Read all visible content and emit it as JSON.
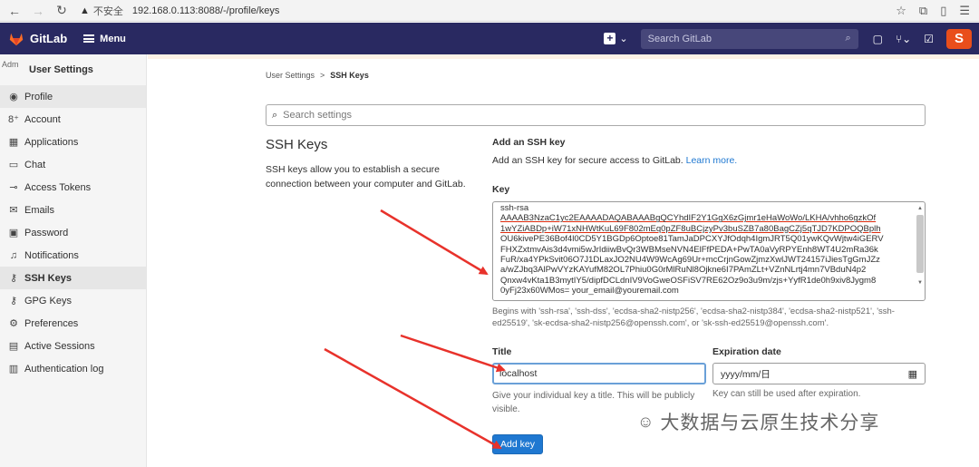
{
  "browser": {
    "insecure_label": "不安全",
    "url": "192.168.0.113:8088/-/profile/keys"
  },
  "header": {
    "brand": "GitLab",
    "menu_label": "Menu",
    "search_placeholder": "Search GitLab",
    "badge_letter": "S"
  },
  "sidebar": {
    "avatar_alt": "Adm",
    "title": "User Settings",
    "items": [
      {
        "label": "Profile",
        "icon": "profile-icon",
        "glyph": "◉"
      },
      {
        "label": "Account",
        "icon": "account-icon",
        "glyph": "8⁺"
      },
      {
        "label": "Applications",
        "icon": "applications-icon",
        "glyph": "▦"
      },
      {
        "label": "Chat",
        "icon": "chat-icon",
        "glyph": "▭"
      },
      {
        "label": "Access Tokens",
        "icon": "token-icon",
        "glyph": "⊸"
      },
      {
        "label": "Emails",
        "icon": "email-icon",
        "glyph": "✉"
      },
      {
        "label": "Password",
        "icon": "lock-icon",
        "glyph": "▣"
      },
      {
        "label": "Notifications",
        "icon": "bell-icon",
        "glyph": "♫"
      },
      {
        "label": "SSH Keys",
        "icon": "key-icon",
        "glyph": "⚷"
      },
      {
        "label": "GPG Keys",
        "icon": "gpg-key-icon",
        "glyph": "⚷"
      },
      {
        "label": "Preferences",
        "icon": "preferences-icon",
        "glyph": "⚙"
      },
      {
        "label": "Active Sessions",
        "icon": "monitor-icon",
        "glyph": "▤"
      },
      {
        "label": "Authentication log",
        "icon": "log-icon",
        "glyph": "▥"
      }
    ]
  },
  "breadcrumb": {
    "parent": "User Settings",
    "separator": ">",
    "current": "SSH Keys"
  },
  "settings_search_placeholder": "Search settings",
  "section": {
    "title": "SSH Keys",
    "description": "SSH keys allow you to establish a secure connection between your computer and GitLab."
  },
  "form": {
    "heading": "Add an SSH key",
    "description": "Add an SSH key for secure access to GitLab.",
    "learn_more": "Learn more.",
    "key_label": "Key",
    "key_lines": [
      "ssh-rsa",
      "AAAAB3NzaC1yc2EAAAADAQABAAABgQCYhdIF2Y1GgX6zGjmr1eHaWoWo/LKHA/vhho6gzkOf",
      "1wYZiABDp+iW71xNHWtKuL69F802mEq0pZF8uBCjzyPv3buSZB7a80BagCZj5qTJD7KDPOQBplh",
      "OU6kivePE36Bof4l0CD5Y1BGDp6Optoe81TamJaDPCXYJfOdqh4IgmJRT5Q01ywKQvWjtw4iGERV",
      "FHXZxtmvAis3d4vmi5wJrIdiiwBvQr3WBMseNVN4ElFfPEDA+PwTA0aVyRPYEnh8WT4U2mRa36k",
      "FuR/xa4YPkSvit06O7J1DLaxJO2NU4W9WcAg69Ur+mcCrjnGowZjmzXwlJWT24157iJiesTgGmJZz",
      "a/wZJbq3AlPwVYzKAYufM82OL7Phiu0G0rMlRuNl8Ojkne6I7PAmZLt+VZnNLrtj4mn7VBduN4p2",
      "Qnxw4vKta1B3mytIY5/dipfDCLdnIV9VoGweOSFiSV7RE62Oz9o3u9m/zjs+YyfR1de0h9xiv8Jygm8",
      "0yFj23x60WMos= your_email@youremail.com"
    ],
    "key_help": "Begins with 'ssh-rsa', 'ssh-dss', 'ecdsa-sha2-nistp256', 'ecdsa-sha2-nistp384', 'ecdsa-sha2-nistp521', 'ssh-ed25519', 'sk-ecdsa-sha2-nistp256@openssh.com', or 'sk-ssh-ed25519@openssh.com'.",
    "title_label": "Title",
    "title_value": "localhost",
    "title_help": "Give your individual key a title. This will be publicly visible.",
    "expiration_label": "Expiration date",
    "expiration_placeholder": "yyyy/mm/日",
    "expiration_help": "Key can still be used after expiration.",
    "submit_label": "Add key"
  },
  "watermark": "大数据与云原生技术分享",
  "colors": {
    "header_bg": "#292961",
    "primary_button": "#1f78d1",
    "annotation_arrow": "#e8322b"
  }
}
